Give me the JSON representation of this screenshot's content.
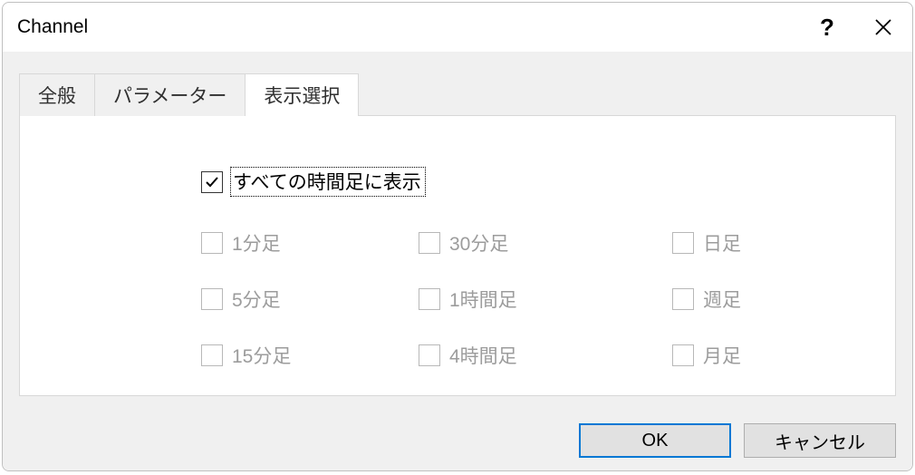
{
  "title": "Channel",
  "tabs": {
    "general": "全般",
    "parameters": "パラメーター",
    "display": "表示選択"
  },
  "master_checkbox_label": "すべての時間足に表示",
  "timeframes": {
    "m1": "1分足",
    "m5": "5分足",
    "m15": "15分足",
    "m30": "30分足",
    "h1": "1時間足",
    "h4": "4時間足",
    "d1": "日足",
    "w1": "週足",
    "mn": "月足"
  },
  "buttons": {
    "ok": "OK",
    "cancel": "キャンセル"
  }
}
